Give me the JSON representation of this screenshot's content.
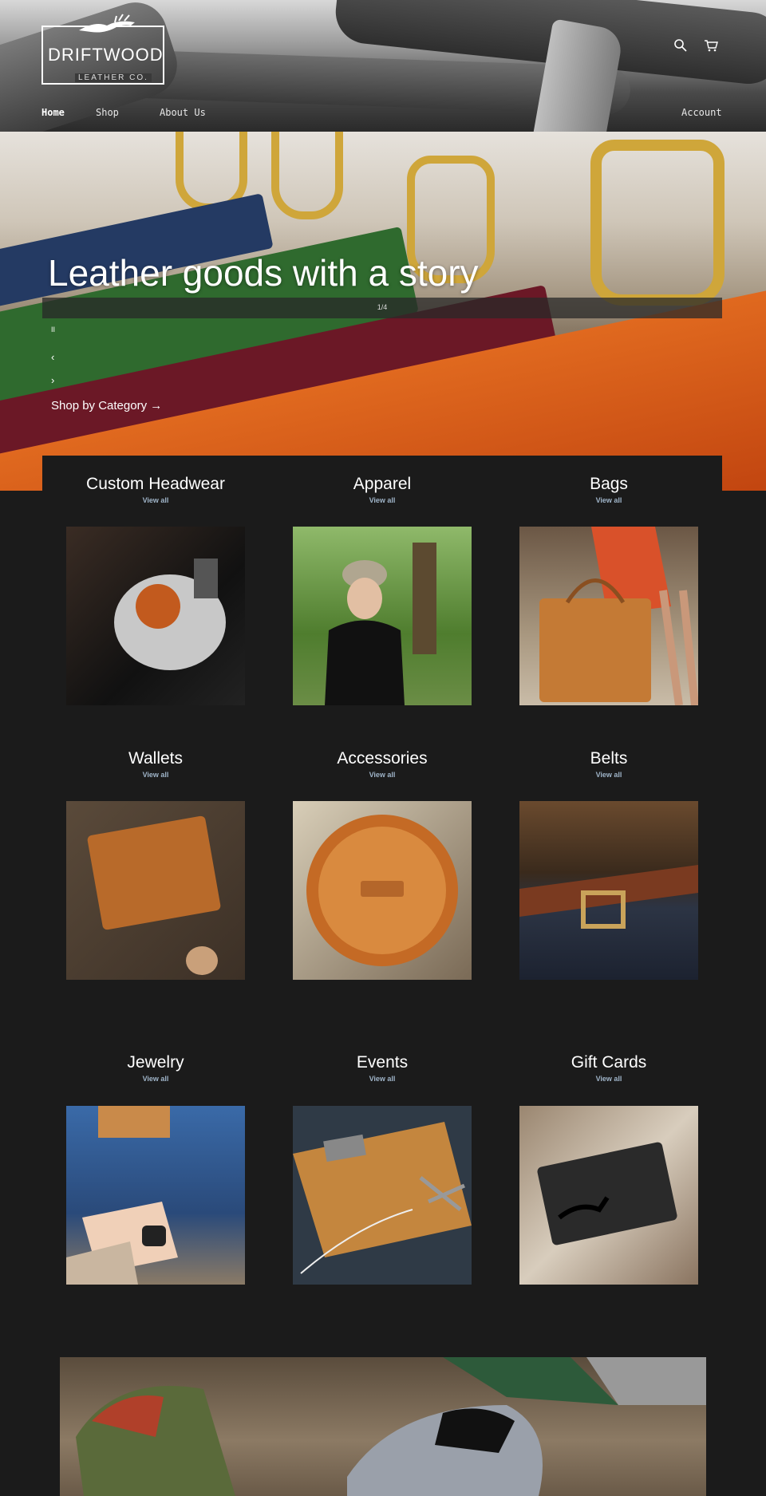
{
  "header": {
    "logo_text": "DRIFTWOOD",
    "logo_subtext": "LEATHER CO.",
    "nav": [
      {
        "label": "Home"
      },
      {
        "label": "Shop"
      },
      {
        "label": "About Us"
      }
    ],
    "account_label": "Account",
    "icons": [
      "search-icon",
      "cart-icon"
    ]
  },
  "hero": {
    "title": "Leather goods with a story",
    "counter": "1/4",
    "pause_symbol": "II",
    "prev_symbol": "‹",
    "next_symbol": "›",
    "cta": "Shop by Category →"
  },
  "categories": [
    {
      "title": "Custom Headwear",
      "link": "View all"
    },
    {
      "title": "Apparel",
      "link": "View all"
    },
    {
      "title": "Bags",
      "link": "View all"
    },
    {
      "title": "Wallets",
      "link": "View all"
    },
    {
      "title": "Accessories",
      "link": "View all"
    },
    {
      "title": "Belts",
      "link": "View all"
    },
    {
      "title": "Jewelry",
      "link": "View all"
    },
    {
      "title": "Events",
      "link": "View all"
    },
    {
      "title": "Gift Cards",
      "link": "View all"
    }
  ],
  "colors": {
    "background": "#1b1b1b",
    "link": "#9fb4c8"
  }
}
